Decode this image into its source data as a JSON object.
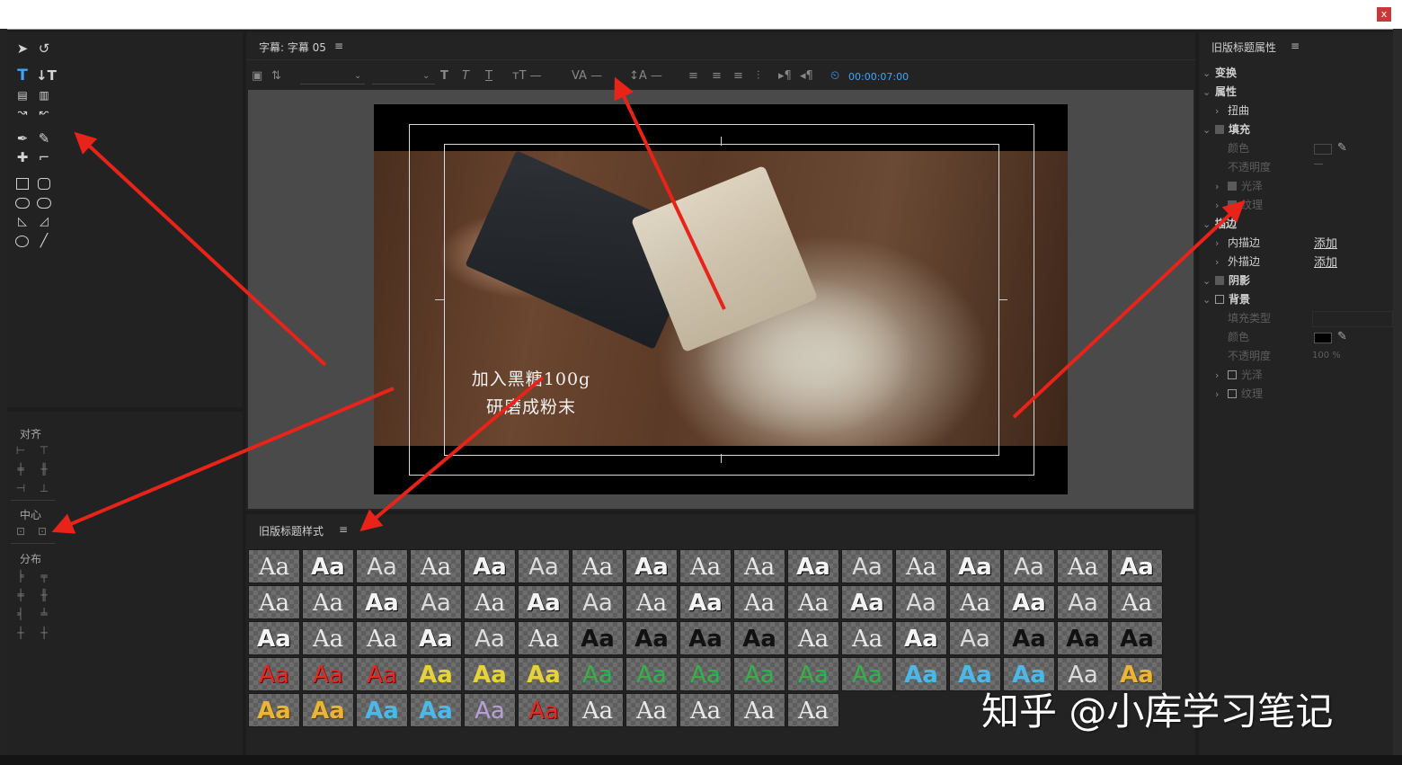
{
  "window": {
    "close_label": "x"
  },
  "tools": {
    "items": [
      "selection-tool",
      "rotation-tool",
      "type-tool",
      "vertical-type-tool",
      "area-type-tool",
      "vertical-area-type-tool",
      "path-type-tool",
      "vertical-path-type-tool",
      "pen-tool",
      "delete-anchor-tool",
      "add-anchor-tool",
      "convert-anchor-tool",
      "rectangle-tool",
      "rounded-rectangle-tool",
      "ellipse-tool",
      "clipped-corner-tool",
      "wedge-tool",
      "arc-tool",
      "circle-tool",
      "line-tool"
    ]
  },
  "align_panel": {
    "align_label": "对齐",
    "center_label": "中心",
    "distribute_label": "分布"
  },
  "main_panel": {
    "title": "字幕: 字幕 05",
    "timecode": "00:00:07:00",
    "caption_line1": "加入黑糖100g",
    "caption_line2": "研磨成粉末"
  },
  "styles_panel": {
    "title": "旧版标题样式",
    "sample_text": "Aa",
    "tile_count": 79
  },
  "props_panel": {
    "title": "旧版标题属性",
    "rows": [
      {
        "label": "变换",
        "indent": 0,
        "dim": false,
        "checkbox": "none"
      },
      {
        "label": "属性",
        "indent": 0,
        "dim": false,
        "checkbox": "none"
      },
      {
        "label": "扭曲",
        "indent": 1,
        "dim": false,
        "checkbox": "none"
      },
      {
        "label": "填充",
        "indent": 0,
        "dim": false,
        "checkbox": "filled"
      },
      {
        "label": "颜色",
        "indent": 1,
        "dim": true,
        "checkbox": "none"
      },
      {
        "label": "不透明度",
        "indent": 1,
        "dim": true,
        "checkbox": "none"
      },
      {
        "label": "光泽",
        "indent": 1,
        "dim": true,
        "checkbox": "filled"
      },
      {
        "label": "纹理",
        "indent": 1,
        "dim": true,
        "checkbox": "filled"
      },
      {
        "label": "描边",
        "indent": 0,
        "dim": false,
        "checkbox": "none"
      },
      {
        "label": "内描边",
        "indent": 1,
        "dim": false,
        "checkbox": "none"
      },
      {
        "label": "外描边",
        "indent": 1,
        "dim": false,
        "checkbox": "none"
      },
      {
        "label": "阴影",
        "indent": 0,
        "dim": false,
        "checkbox": "filled"
      },
      {
        "label": "背景",
        "indent": 0,
        "dim": false,
        "checkbox": "empty"
      },
      {
        "label": "填充类型",
        "indent": 1,
        "dim": true,
        "checkbox": "none"
      },
      {
        "label": "颜色",
        "indent": 1,
        "dim": true,
        "checkbox": "none"
      },
      {
        "label": "不透明度",
        "indent": 1,
        "dim": true,
        "checkbox": "none"
      },
      {
        "label": "光泽",
        "indent": 1,
        "dim": true,
        "checkbox": "empty"
      },
      {
        "label": "纹理",
        "indent": 1,
        "dim": true,
        "checkbox": "empty"
      }
    ],
    "inner_stroke_action": "添加",
    "outer_stroke_action": "添加",
    "bg_opacity_value": "100 %"
  },
  "watermark": "知乎 @小库学习笔记",
  "colors": {
    "accent": "#3ea6ff",
    "arrow": "#e8231a",
    "panel": "#232323"
  }
}
